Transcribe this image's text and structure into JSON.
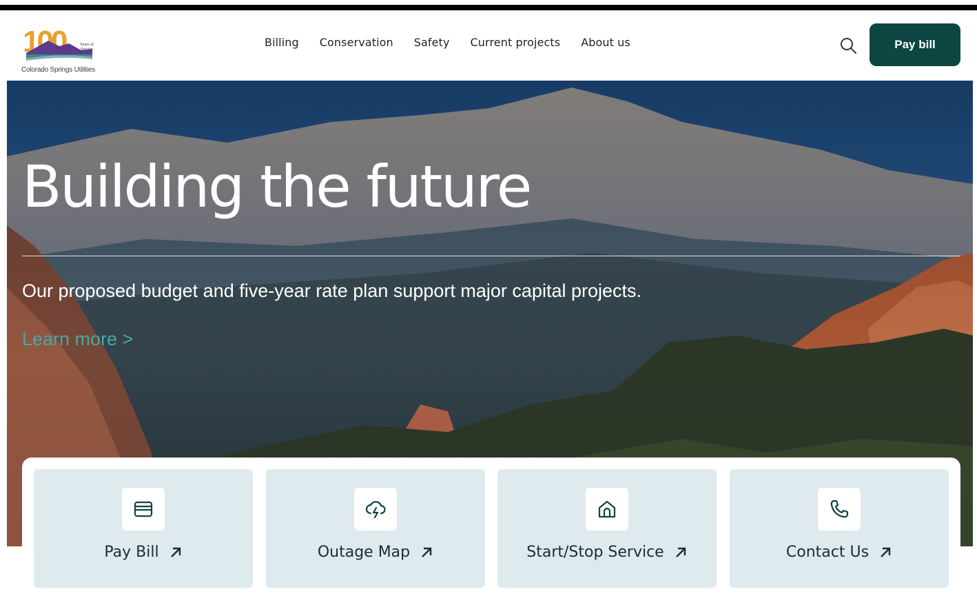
{
  "colors": {
    "brand_dark_teal": "#0d4542",
    "link_teal": "#46a9a8",
    "card_bg": "#deeaed",
    "logo_orange": "#e8a12e",
    "logo_purple": "#5b3b8c"
  },
  "header": {
    "logo": {
      "number": "100",
      "years_text": "Years of Service",
      "caption": "Colorado Springs Utilities"
    },
    "nav": [
      {
        "label": "Billing"
      },
      {
        "label": "Conservation"
      },
      {
        "label": "Safety"
      },
      {
        "label": "Current projects"
      },
      {
        "label": "About us"
      }
    ],
    "search_icon": "search-icon",
    "pay_bill_label": "Pay bill"
  },
  "hero": {
    "title": "Building the future",
    "subtitle": "Our proposed budget and five-year rate plan support major capital projects.",
    "link_label": "Learn more >"
  },
  "quick_links": [
    {
      "label": "Pay Bill",
      "icon": "wallet-icon"
    },
    {
      "label": "Outage Map",
      "icon": "cloud-lightning-icon"
    },
    {
      "label": "Start/Stop Service",
      "icon": "home-icon"
    },
    {
      "label": "Contact Us",
      "icon": "phone-icon"
    }
  ]
}
